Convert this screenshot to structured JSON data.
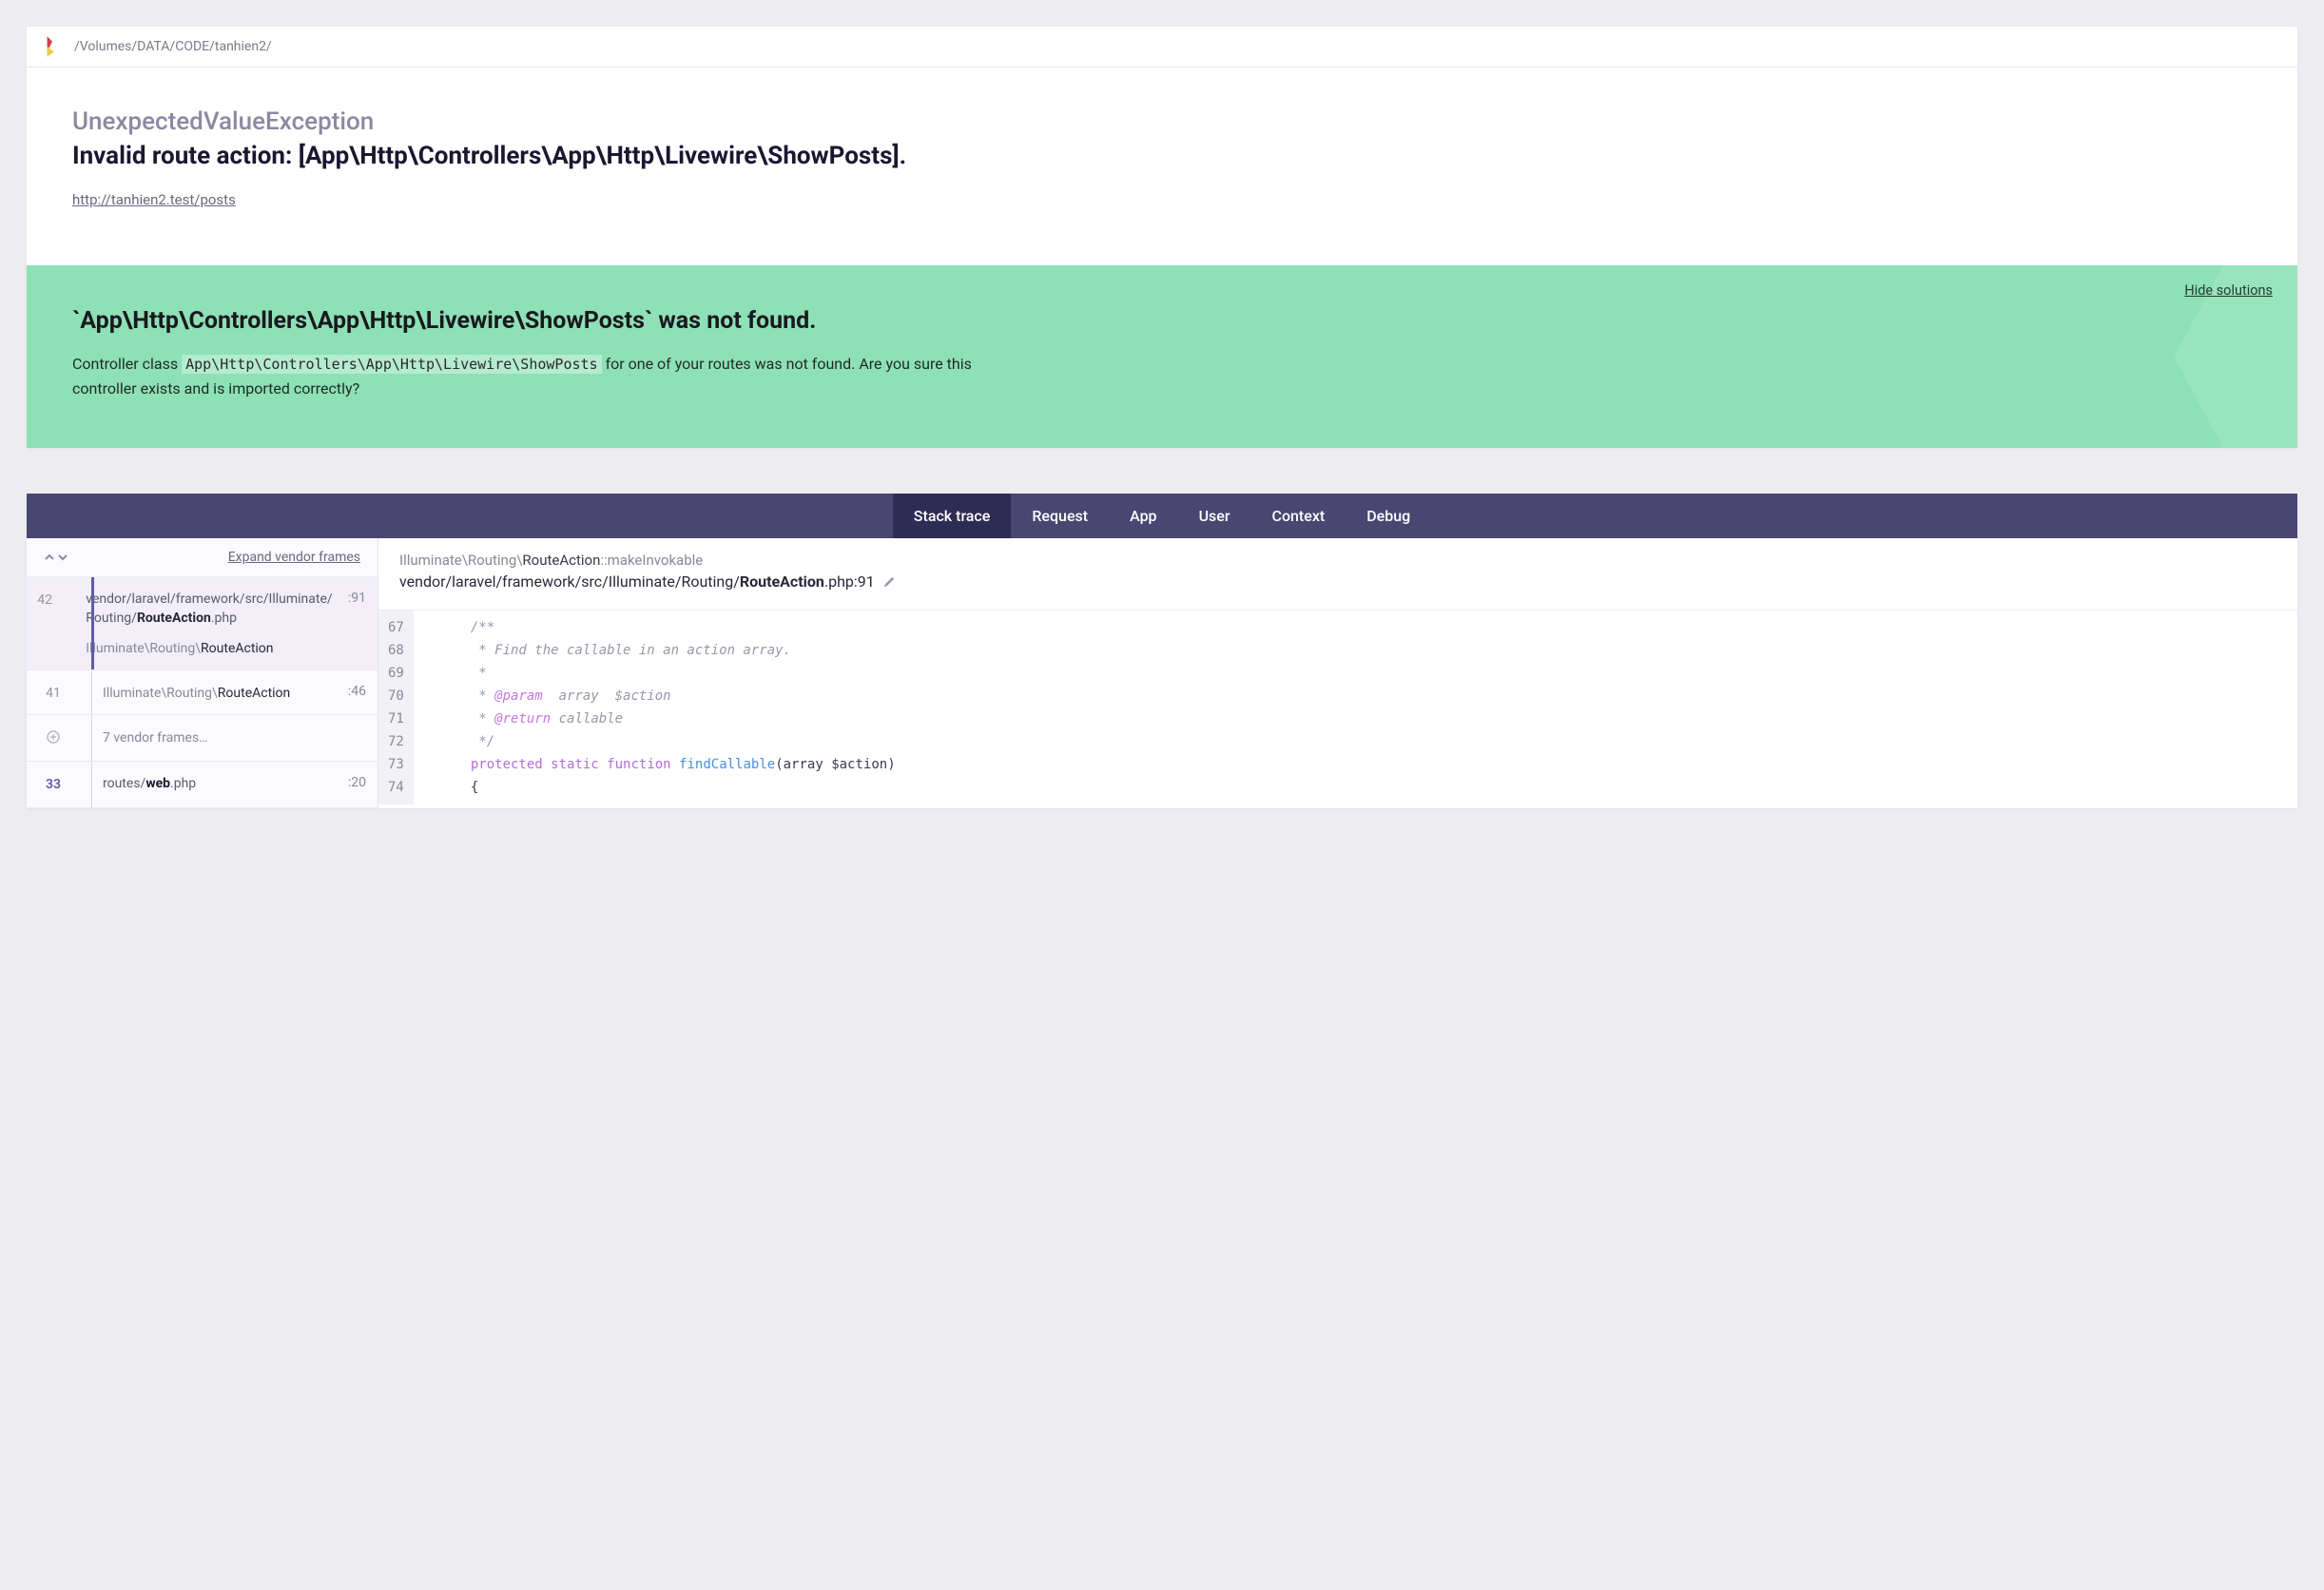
{
  "header": {
    "path": "/Volumes/DATA/CODE/tanhien2/"
  },
  "exception": {
    "class": "UnexpectedValueException",
    "message": "Invalid route action: [App\\Http\\Controllers\\App\\Http\\Livewire\\ShowPosts].",
    "url": "http://tanhien2.test/posts"
  },
  "solution": {
    "hide_label": "Hide solutions",
    "title": "`App\\Http\\Controllers\\App\\Http\\Livewire\\ShowPosts` was not found.",
    "text_before": "Controller class ",
    "code": "App\\Http\\Controllers\\App\\Http\\Livewire\\ShowPosts",
    "text_after": " for one of your routes was not found. Are you sure this controller exists and is imported correctly?"
  },
  "tabs": {
    "items": [
      "Stack trace",
      "Request",
      "App",
      "User",
      "Context",
      "Debug"
    ],
    "active": 0
  },
  "framesHeader": {
    "expand": "Expand vendor frames"
  },
  "frames": [
    {
      "num": "42",
      "path_pre": "vendor/laravel/framework/src/Illuminate/\nRouting/",
      "path_bold": "RouteAction",
      "path_ext": ".php",
      "sub_pre": "Illuminate\\Routing\\",
      "sub_bold": "RouteAction",
      "line": ":91",
      "active": true
    },
    {
      "num": "41",
      "sub_pre": "Illuminate\\Routing\\",
      "sub_bold": "RouteAction",
      "line": ":46"
    },
    {
      "num": "",
      "vendor": "7 vendor frames…",
      "plus": true
    },
    {
      "num": "33",
      "path_pre": "routes/",
      "path_bold": "web",
      "path_ext": ".php",
      "line": ":20",
      "current": true
    }
  ],
  "codeHeader": {
    "ns_pre": "Illuminate\\Routing\\",
    "ns_bold": "RouteAction",
    "ns_method": "::makeInvokable",
    "file_pre": "vendor/laravel/framework/src/Illuminate/Routing/",
    "file_bold": "RouteAction",
    "file_suffix": ".php:91"
  },
  "code": {
    "start": 67,
    "lines": [
      {
        "n": 67,
        "t": "/**",
        "cls": "c-comment"
      },
      {
        "n": 68,
        "t": " * Find the callable in an action array.",
        "cls": "c-comment"
      },
      {
        "n": 69,
        "t": " *",
        "cls": "c-comment"
      },
      {
        "n": 70,
        "html": " * <span class='c-tag'>@param</span>  array  $action",
        "cls": "c-comment"
      },
      {
        "n": 71,
        "html": " * <span class='c-tag'>@return</span> callable",
        "cls": "c-comment"
      },
      {
        "n": 72,
        "t": " */",
        "cls": "c-comment"
      },
      {
        "n": 73,
        "html": "<span class='c-kw'>protected</span> <span class='c-kw'>static</span> <span class='c-kw'>function</span> <span class='c-fn'>findCallable</span>(array $action)"
      },
      {
        "n": 74,
        "t": "{"
      }
    ]
  }
}
